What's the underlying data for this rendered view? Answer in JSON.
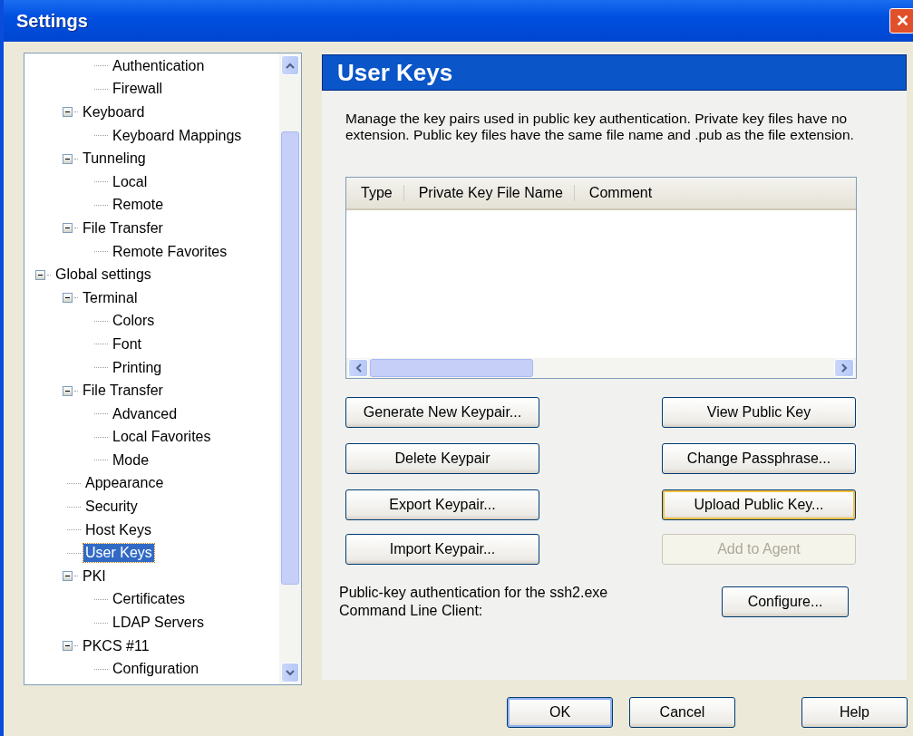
{
  "window": {
    "title": "Settings",
    "close": "✕"
  },
  "tree": {
    "items": [
      {
        "children": [
          {
            "children": [
              {
                "label": "Authentication",
                "selected": false
              },
              {
                "label": "Firewall",
                "selected": false
              }
            ]
          },
          {
            "label": "Keyboard",
            "expanded": true,
            "selected": false,
            "children": [
              {
                "label": "Keyboard Mappings",
                "selected": false
              }
            ]
          },
          {
            "label": "Tunneling",
            "expanded": true,
            "selected": false,
            "children": [
              {
                "label": "Local",
                "selected": false
              },
              {
                "label": "Remote",
                "selected": false
              }
            ]
          },
          {
            "label": "File Transfer",
            "expanded": true,
            "selected": false,
            "children": [
              {
                "label": "Remote Favorites",
                "selected": false
              }
            ]
          }
        ]
      },
      {
        "label": "Global settings",
        "expanded": true,
        "selected": false,
        "children": [
          {
            "label": "Terminal",
            "expanded": true,
            "selected": false,
            "children": [
              {
                "label": "Colors",
                "selected": false
              },
              {
                "label": "Font",
                "selected": false
              },
              {
                "label": "Printing",
                "selected": false
              }
            ]
          },
          {
            "label": "File Transfer",
            "expanded": true,
            "selected": false,
            "children": [
              {
                "label": "Advanced",
                "selected": false
              },
              {
                "label": "Local Favorites",
                "selected": false
              },
              {
                "label": "Mode",
                "selected": false
              }
            ]
          },
          {
            "label": "Appearance",
            "selected": false
          },
          {
            "label": "Security",
            "selected": false
          },
          {
            "label": "Host Keys",
            "selected": false
          },
          {
            "label": "User Keys",
            "selected": true
          },
          {
            "label": "PKI",
            "expanded": true,
            "selected": false,
            "children": [
              {
                "label": "Certificates",
                "selected": false
              },
              {
                "label": "LDAP Servers",
                "selected": false
              }
            ]
          },
          {
            "label": "PKCS #11",
            "expanded": true,
            "selected": false,
            "children": [
              {
                "label": "Configuration",
                "selected": false
              }
            ]
          }
        ]
      }
    ]
  },
  "panel": {
    "title": "User Keys",
    "description": "Manage the key pairs used in public key authentication. Private key files have no extension. Public key files have the same file name and .pub as the file extension.",
    "table": {
      "columns": [
        "Type",
        "Private Key File Name",
        "Comment"
      ]
    },
    "left_buttons": [
      {
        "label": "Generate New Keypair...",
        "disabled": false,
        "focused": false
      },
      {
        "label": "Delete Keypair",
        "disabled": false,
        "focused": false
      },
      {
        "label": "Export Keypair...",
        "disabled": false,
        "focused": false
      },
      {
        "label": "Import Keypair...",
        "disabled": false,
        "focused": false
      }
    ],
    "right_buttons": [
      {
        "label": "View Public Key",
        "disabled": false,
        "focused": false
      },
      {
        "label": "Change Passphrase...",
        "disabled": false,
        "focused": false
      },
      {
        "label": "Upload Public Key...",
        "disabled": false,
        "focused": true
      },
      {
        "label": "Add to Agent",
        "disabled": true,
        "focused": false
      }
    ],
    "cli_label": "Public-key authentication for the ssh2.exe Command Line Client:",
    "configure_button": "Configure..."
  },
  "buttons": [
    {
      "label": "OK",
      "default": true
    },
    {
      "label": "Cancel",
      "default": false
    },
    {
      "label": "Help",
      "default": false
    }
  ]
}
